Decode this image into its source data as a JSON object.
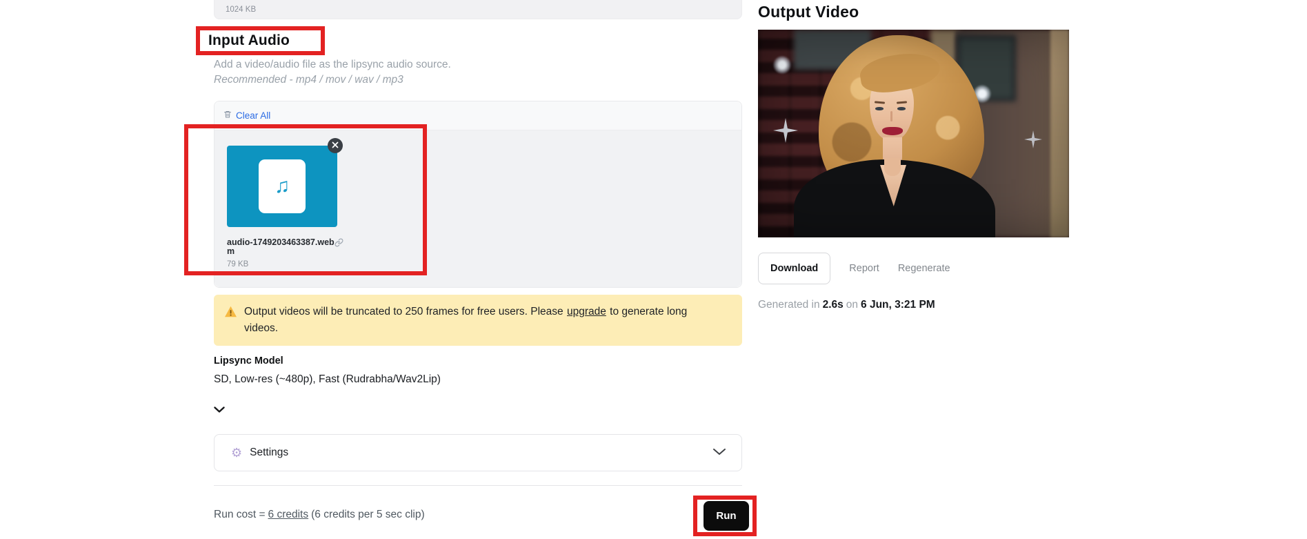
{
  "colors": {
    "annotation_red": "#e32222",
    "audio_tile_teal": "#0d94c0",
    "warning_bg": "#fdedb6",
    "link_blue": "#2b6be4",
    "run_button_bg": "#0c0c0c"
  },
  "icons": {
    "music_note": "♫",
    "gear": "⚙"
  },
  "previous_file": {
    "size": "1024 KB"
  },
  "input_audio": {
    "title": "Input Audio",
    "description": "Add a video/audio file as the lipsync audio source.",
    "recommended": "Recommended - mp4 / mov / wav / mp3",
    "clear_all_label": "Clear All",
    "file": {
      "name": "audio-1749203463387.webm",
      "size": "79 KB"
    }
  },
  "warning": {
    "part1": "Output videos will be truncated to 250 frames for free users. Please",
    "link": "upgrade",
    "part2": "to generate long videos."
  },
  "model": {
    "label": "Lipsync Model",
    "value": "SD, Low-res (~480p), Fast (Rudrabha/Wav2Lip)"
  },
  "settings": {
    "label": "Settings"
  },
  "run": {
    "cost_prefix": "Run cost =",
    "cost_link": "6 credits",
    "cost_suffix": "(6 credits per 5 sec clip)",
    "button_label": "Run"
  },
  "output": {
    "title": "Output Video",
    "download_label": "Download",
    "report_label": "Report",
    "regenerate_label": "Regenerate",
    "generated_prefix": "Generated in",
    "generated_duration": "2.6s",
    "generated_on": "on",
    "generated_datetime": "6 Jun, 3:21 PM"
  }
}
